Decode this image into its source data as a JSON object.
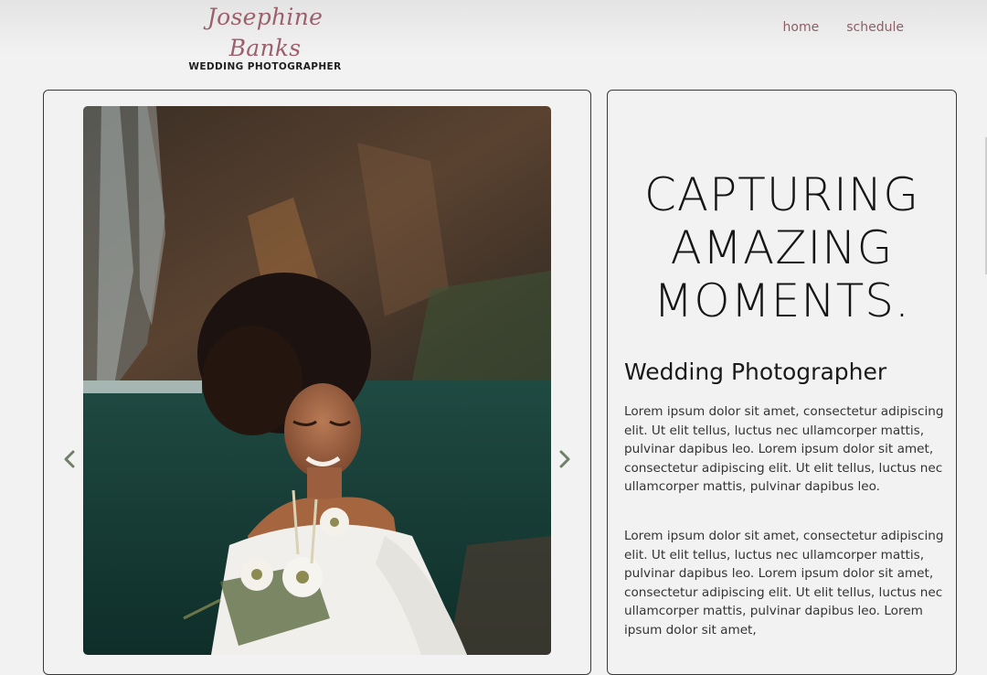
{
  "brand": {
    "name": "Josephine Banks",
    "tagline": "WEDDING PHOTOGRAPHER"
  },
  "nav": {
    "items": [
      {
        "label": "home"
      },
      {
        "label": "schedule"
      }
    ]
  },
  "gallery": {
    "prev_icon": "chevron-left-icon",
    "next_icon": "chevron-right-icon",
    "accent": "#6f7f68"
  },
  "hero": {
    "headline_lines": [
      "CAPTURING",
      "AMAZING",
      "MOMENTS."
    ],
    "subheading": "Wedding Photographer",
    "paragraphs": [
      "Lorem ipsum dolor sit amet, consectetur adipiscing elit. Ut elit tellus, luctus nec ullamcorper mattis, pulvinar dapibus leo. Lorem ipsum dolor sit amet, consectetur adipiscing elit. Ut elit tellus, luctus nec ullamcorper mattis, pulvinar dapibus leo.",
      "Lorem ipsum dolor sit amet, consectetur adipiscing elit. Ut elit tellus, luctus nec ullamcorper mattis, pulvinar dapibus leo. Lorem ipsum dolor sit amet, consectetur adipiscing elit. Ut elit tellus, luctus nec ullamcorper mattis, pulvinar dapibus leo. Lorem ipsum dolor sit amet,"
    ]
  },
  "colors": {
    "brand": "#9c5f6c",
    "nav": "#8f5e67",
    "background": "#f2f2f2",
    "border": "#3a3a3a"
  }
}
